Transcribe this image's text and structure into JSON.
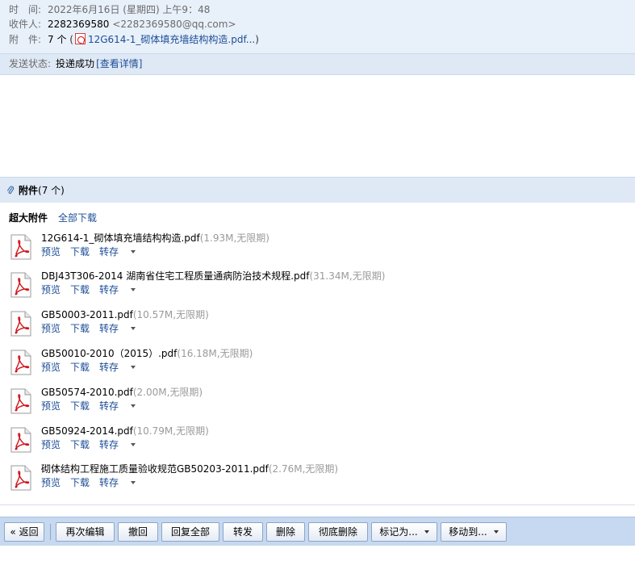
{
  "meta": {
    "time_label": "时　间:",
    "time_value": "2022年6月16日 (星期四) 上午9：48",
    "to_label": "收件人:",
    "to_name": "2282369580",
    "to_addr": "<2282369580@qq.com>",
    "att_label": "附　件:",
    "att_count": "7 个",
    "att_open": "(",
    "att_first": "12G614-1_砌体填充墙结构构造.pdf...",
    "att_close": ")"
  },
  "status": {
    "label": "发送状态:",
    "value": "投递成功",
    "detail": "[查看详情]"
  },
  "attachments": {
    "title": "附件",
    "count": "(7 个)",
    "big_label": "超大附件",
    "download_all": "全部下载",
    "action_preview": "预览",
    "action_download": "下载",
    "action_save": "转存",
    "items": [
      {
        "name": "12G614-1_砌体填充墙结构构造.pdf",
        "info": "(1.93M,无限期)"
      },
      {
        "name": "DBJ43T306-2014 湖南省住宅工程质量通病防治技术规程.pdf",
        "info": "(31.34M,无限期)"
      },
      {
        "name": "GB50003-2011.pdf",
        "info": "(10.57M,无限期)"
      },
      {
        "name": "GB50010-2010（2015）.pdf",
        "info": "(16.18M,无限期)"
      },
      {
        "name": "GB50574-2010.pdf",
        "info": "(2.00M,无限期)"
      },
      {
        "name": "GB50924-2014.pdf",
        "info": "(10.79M,无限期)"
      },
      {
        "name": "砌体结构工程施工质量验收规范GB50203-2011.pdf",
        "info": "(2.76M,无限期)"
      }
    ]
  },
  "toolbar": {
    "back": "« 返回",
    "edit_again": "再次编辑",
    "recall": "撤回",
    "reply_all": "回复全部",
    "forward": "转发",
    "delete": "删除",
    "delete_forever": "彻底删除",
    "mark_as": "标记为...",
    "move_to": "移动到..."
  },
  "colors": {
    "link": "#1c4d96",
    "header_bg": "#e8f0fa",
    "toolbar_bg": "#c6d9f0",
    "muted": "#9a9a9a"
  }
}
